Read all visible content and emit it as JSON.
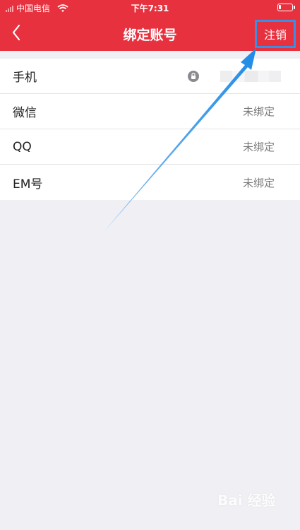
{
  "status_bar": {
    "carrier": "中国电信",
    "time": "下午7:31"
  },
  "nav": {
    "title": "绑定账号",
    "logout_label": "注销"
  },
  "accounts": [
    {
      "label": "手机",
      "value": ""
    },
    {
      "label": "微信",
      "value": "未绑定"
    },
    {
      "label": "QQ",
      "value": "未绑定"
    },
    {
      "label": "EM号",
      "value": "未绑定"
    }
  ],
  "watermark": "Bai 经验",
  "colors": {
    "header": "#e8313f",
    "highlight": "#3b8fe0",
    "background": "#efeff4"
  },
  "icons": {
    "back": "chevron-left-icon",
    "lock": "lock-icon"
  }
}
